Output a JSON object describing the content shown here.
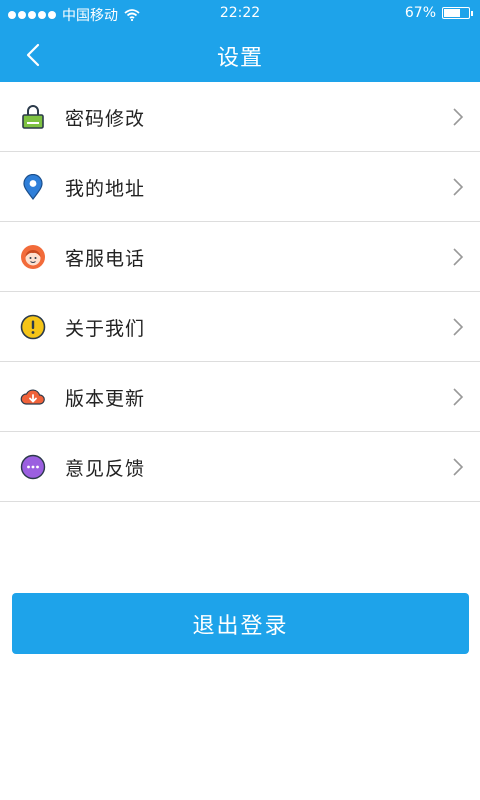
{
  "status_bar": {
    "carrier": "中国移动",
    "time": "22:22",
    "battery_text": "67%",
    "battery_level": 0.67
  },
  "nav": {
    "title": "设置",
    "back_icon": "chevron-left-icon"
  },
  "settings_items": [
    {
      "label": "密码修改",
      "icon": "lock-icon",
      "color": "#7ec242"
    },
    {
      "label": "我的地址",
      "icon": "location-pin-icon",
      "color": "#2f7fd9"
    },
    {
      "label": "客服电话",
      "icon": "customer-service-icon",
      "color": "#f26b3a"
    },
    {
      "label": "关于我们",
      "icon": "info-icon",
      "color": "#f5c518"
    },
    {
      "label": "版本更新",
      "icon": "cloud-download-icon",
      "color": "#f0623a"
    },
    {
      "label": "意见反馈",
      "icon": "chat-bubble-icon",
      "color": "#9b5fe0"
    }
  ],
  "logout": {
    "label": "退出登录"
  },
  "colors": {
    "primary": "#1ea3ea",
    "divider": "#dddddd",
    "chevron": "#999999"
  }
}
